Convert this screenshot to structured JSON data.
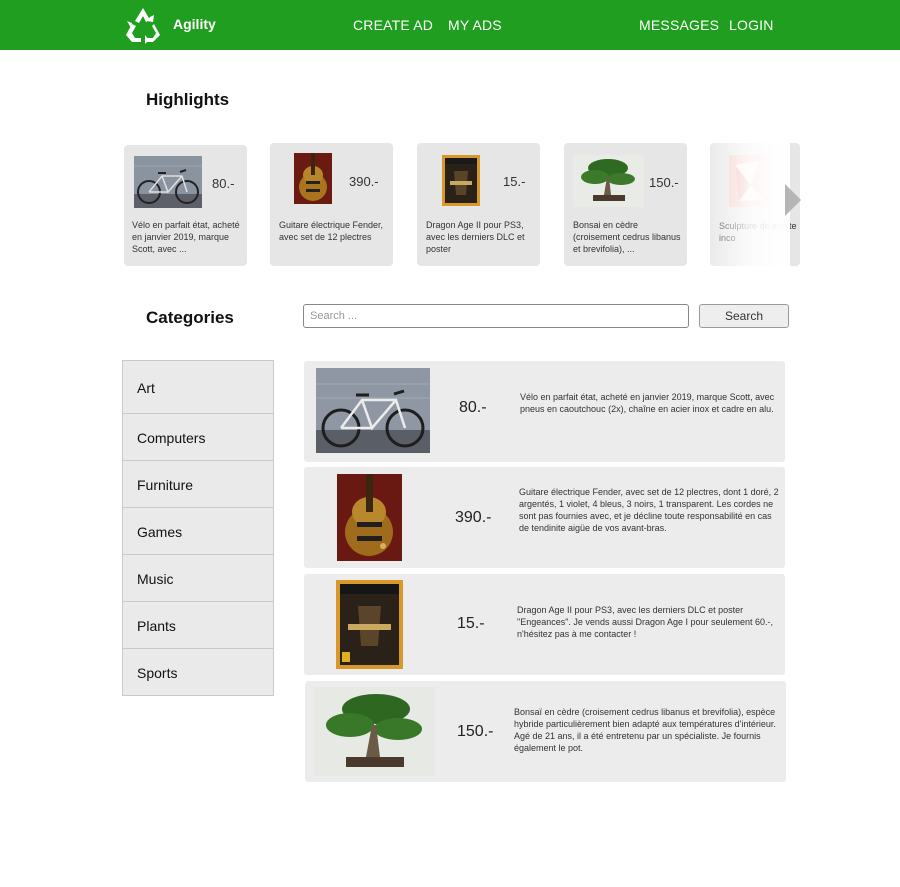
{
  "brand": {
    "name": "Agility",
    "logo_icon": "recycle-icon"
  },
  "nav": {
    "create_ad": "CREATE AD",
    "my_ads": "MY ADS",
    "messages": "MESSAGES",
    "login": "LOGIN"
  },
  "colors": {
    "topbar": "#1f9e1f",
    "card_bg": "#e6e6e6",
    "category_bg": "#eaeaea"
  },
  "highlights": {
    "title": "Highlights",
    "next_icon": "chevron-right-icon",
    "items": [
      {
        "price": "80.-",
        "desc": "Vélo en parfait état, acheté en janvier 2019, marque Scott, avec ...",
        "image": "bicycle-photo"
      },
      {
        "price": "390.-",
        "desc": "Guitare électrique Fender, avec set de 12 plectres",
        "image": "guitar-photo"
      },
      {
        "price": "15.-",
        "desc": "Dragon Age II pour PS3, avec les derniers DLC et poster",
        "image": "game-box-photo"
      },
      {
        "price": "150.-",
        "desc": "Bonsai en cèdre (croisement cedrus libanus et brevifolia), ...",
        "image": "bonsai-photo"
      },
      {
        "price": "",
        "desc": "Sculpture de artiste inco",
        "image": "sculpture-photo"
      }
    ]
  },
  "categories": {
    "title": "Categories",
    "items": [
      "Art",
      "Computers",
      "Furniture",
      "Games",
      "Music",
      "Plants",
      "Sports"
    ]
  },
  "search": {
    "placeholder": "Search ...",
    "value": "",
    "button_label": "Search"
  },
  "listings": [
    {
      "price": "80.-",
      "desc": "Vélo en parfait état, acheté en janvier 2019, marque Scott, avec pneus en caoutchouc (2x), chaîne en acier inox et cadre en alu."
    },
    {
      "price": "390.-",
      "desc": "Guitare électrique Fender, avec set de 12 plectres, dont 1 doré, 2 argentés, 1 violet, 4 bleus, 3 noirs, 1 transparent. Les cordes ne sont pas fournies avec, et je décline toute responsabilité en cas de tendinite aigüe de vos avant-bras."
    },
    {
      "price": "15.-",
      "desc": "Dragon Age II pour PS3, avec les derniers DLC et poster \"Engeances\". Je vends aussi Dragon Age I pour seulement 60.-, n'hésitez pas à me contacter !"
    },
    {
      "price": "150.-",
      "desc": "Bonsaï en cèdre (croisement cedrus libanus et brevifolia), espèce hybride particulièrement bien adapté aux températures d'intérieur. Agé de 21 ans, il a été entretenu par un spécialiste. Je fournis également le pot."
    }
  ]
}
